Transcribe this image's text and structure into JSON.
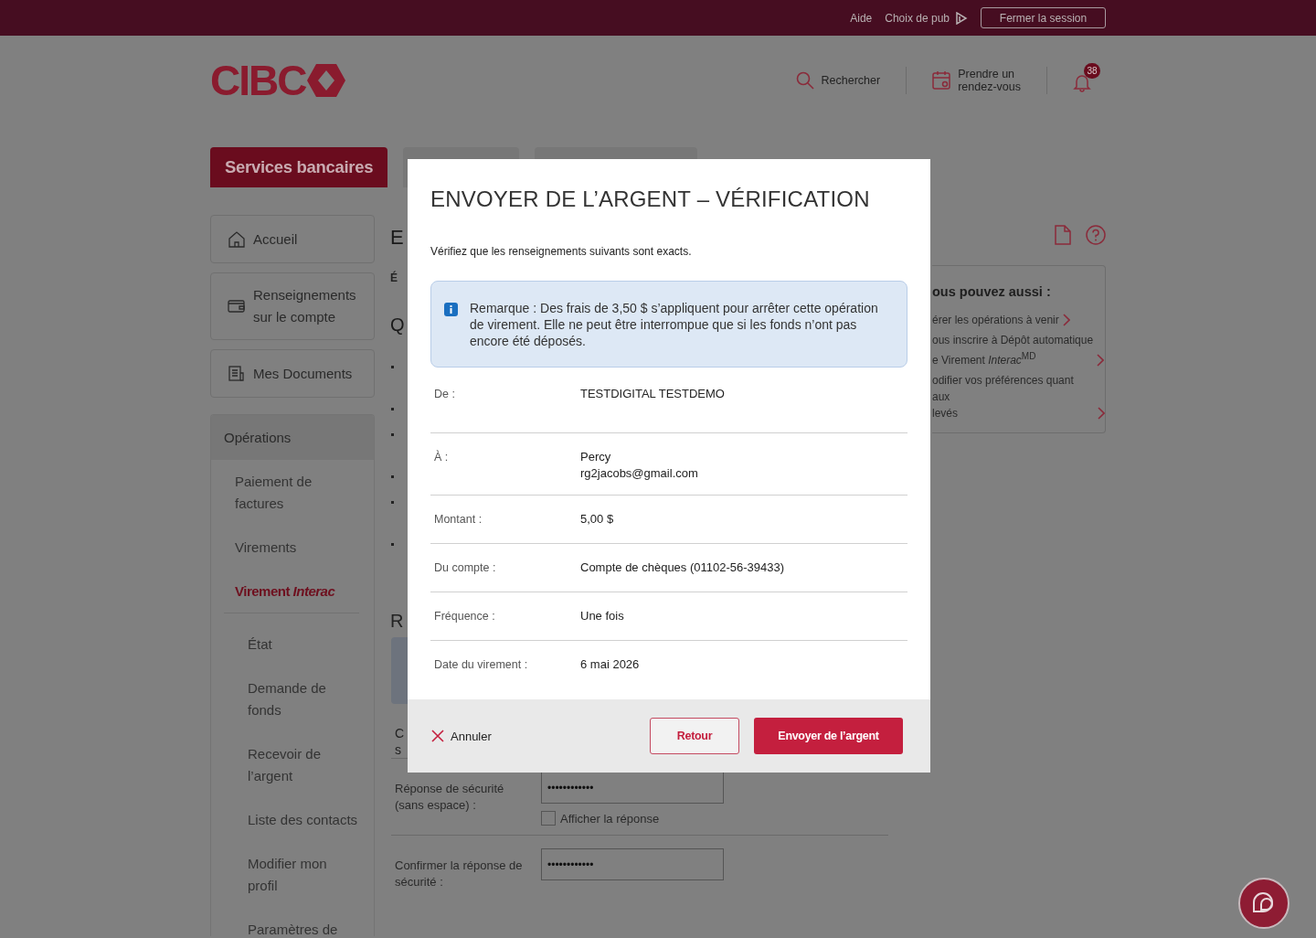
{
  "top_bar": {
    "links": [
      "Aide",
      "Choix de pub"
    ],
    "logout_button": "Fermer la session"
  },
  "header": {
    "logo": "CIBC",
    "search": "Rechercher",
    "appointment": "Prendre un\nrendez-vous",
    "notification_count": "38"
  },
  "tabs": [
    {
      "label": "Services bancaires",
      "selected": true
    },
    {
      "selected": false
    },
    {
      "selected": false
    }
  ],
  "sidebar": {
    "cards": [
      "Accueil",
      "Renseignements\nsur le compte",
      "Mes Documents"
    ],
    "section": {
      "title": "Opérations",
      "items": [
        {
          "label": "Paiement de\nfactures",
          "selected": false
        },
        {
          "label": "Virements",
          "selected": false
        },
        {
          "label": "Virement *Interac*",
          "selected": true,
          "children": [
            {
              "label": "État"
            },
            {
              "label": "Demande de\nfonds"
            },
            {
              "label": "Recevoir de\nl’argent"
            },
            {
              "label": "Liste des contacts"
            },
            {
              "label": "Modifier mon\nprofil"
            },
            {
              "label": "Paramètres de"
            }
          ]
        }
      ]
    }
  },
  "main": {
    "heading_1": "E",
    "text_1": "É",
    "heading_2": "Q",
    "heading_3": "R",
    "label_1": "C\ns",
    "security_form": [
      {
        "label": "Réponse de sécurité\n(sans espace) :",
        "value": "••••••••••••",
        "show_answer": {
          "label": "Afficher la réponse",
          "checked": false
        }
      },
      {
        "label": "Confirmer la réponse de\nsécurité :",
        "value": "••••••••••••"
      }
    ]
  },
  "side_panel": {
    "title": "ous pouvez aussi :",
    "links": [
      "érer les opérations à venir",
      "ous inscrire à Dépôt automatique\ne Virement *Interac*$^{MD}$",
      "odifier vos préférences quant aux\nlevés"
    ]
  },
  "modal": {
    "title": "ENVOYER DE L’ARGENT – VÉRIFICATION",
    "intro": "Vérifiez que les renseignements suivants sont exacts.",
    "note": "Remarque : Des frais de 3,50 $ s’appliquent pour arrêter cette opération de virement. Elle ne peut être interrompue que si les fonds n’ont pas encore été déposés.",
    "details": [
      {
        "label": "De :",
        "value": "TESTDIGITAL TESTDEMO"
      },
      {
        "label": "À :",
        "value": "Percy\nrg2jacobs@gmail.com"
      },
      {
        "label": "Montant :",
        "value": "5,00 $"
      },
      {
        "label": "Du compte :",
        "value": "Compte de chèques (01102-56-39433)"
      },
      {
        "label": "Fréquence :",
        "value": "Une fois"
      },
      {
        "label": "Date du virement :",
        "value": "6 mai 2026"
      }
    ],
    "cancel": "Annuler",
    "back_button": "Retour",
    "submit_button": "Envoyer de l’argent"
  }
}
